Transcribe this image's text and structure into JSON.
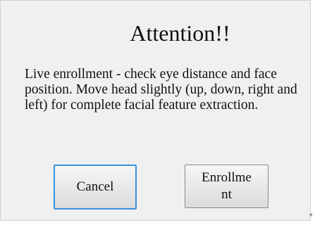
{
  "dialog": {
    "title": "Attention!!",
    "message": "Live enrollment - check eye distance and face position.  Move head slightly (up, down, right and left) for complete facial feature extraction.",
    "buttons": {
      "cancel_label": "Cancel",
      "enroll_label_line1": "Enrollme",
      "enroll_label_line2": "nt"
    }
  }
}
